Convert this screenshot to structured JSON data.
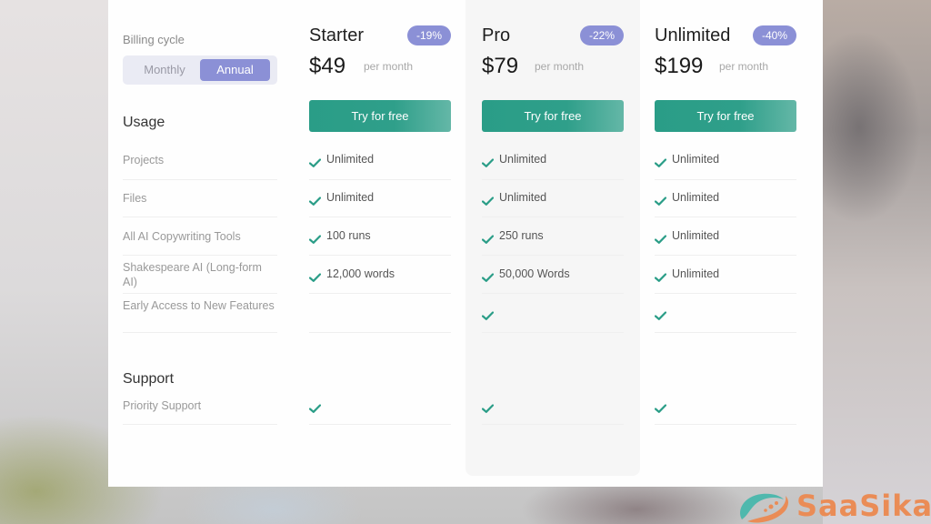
{
  "billing": {
    "label": "Billing cycle",
    "options": [
      "Monthly",
      "Annual"
    ],
    "selected": "Annual"
  },
  "sections": {
    "usage": "Usage",
    "support": "Support"
  },
  "features": {
    "usage": [
      "Projects",
      "Files",
      "All AI Copywriting Tools",
      "Shakespeare AI (Long-form AI)",
      "Early Access to New Features"
    ],
    "support": [
      "Priority Support"
    ]
  },
  "plans": [
    {
      "name": "Starter",
      "discount": "-19%",
      "price": "$49",
      "period": "per month",
      "cta": "Try for free",
      "usage": [
        {
          "check": true,
          "text": "Unlimited"
        },
        {
          "check": true,
          "text": "Unlimited"
        },
        {
          "check": true,
          "text": "100 runs"
        },
        {
          "check": true,
          "text": "12,000 words"
        },
        {
          "check": false,
          "text": ""
        }
      ],
      "support": [
        {
          "check": true,
          "text": ""
        }
      ]
    },
    {
      "name": "Pro",
      "discount": "-22%",
      "price": "$79",
      "period": "per month",
      "cta": "Try for free",
      "highlighted": true,
      "usage": [
        {
          "check": true,
          "text": "Unlimited"
        },
        {
          "check": true,
          "text": "Unlimited"
        },
        {
          "check": true,
          "text": "250 runs"
        },
        {
          "check": true,
          "text": "50,000 Words"
        },
        {
          "check": true,
          "text": ""
        }
      ],
      "support": [
        {
          "check": true,
          "text": ""
        }
      ]
    },
    {
      "name": "Unlimited",
      "discount": "-40%",
      "price": "$199",
      "period": "per month",
      "cta": "Try for free",
      "usage": [
        {
          "check": true,
          "text": "Unlimited"
        },
        {
          "check": true,
          "text": "Unlimited"
        },
        {
          "check": true,
          "text": "Unlimited"
        },
        {
          "check": true,
          "text": "Unlimited"
        },
        {
          "check": true,
          "text": ""
        }
      ],
      "support": [
        {
          "check": true,
          "text": ""
        }
      ]
    }
  ],
  "colors": {
    "accent": "#8b90d6",
    "cta": "#2a9d87",
    "check": "#2a9d87",
    "watermark": "#ea8c56"
  },
  "watermark": {
    "text": "SaaSika"
  }
}
